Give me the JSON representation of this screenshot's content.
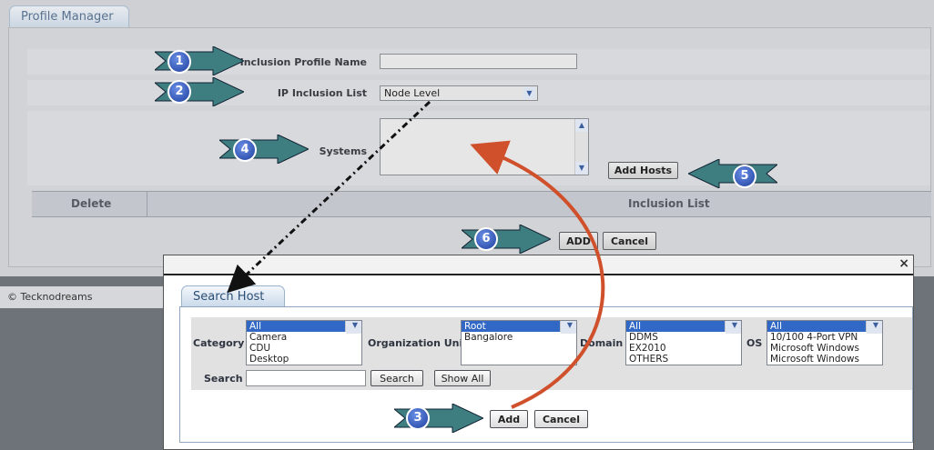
{
  "profile_manager": {
    "tab": "Profile Manager",
    "labels": {
      "inclusion_profile_name": "Inclusion Profile Name",
      "ip_inclusion_list": "IP Inclusion List",
      "systems": "Systems"
    },
    "inclusion_profile_name_value": "",
    "ip_inclusion_list_value": "Node Level",
    "add_hosts": "Add Hosts",
    "grid_headers": [
      "Delete",
      "Inclusion List"
    ],
    "add": "ADD",
    "cancel": "Cancel"
  },
  "footer": {
    "text": "© Tecknodreams"
  },
  "dialog": {
    "close": "×",
    "tab": "Search Host",
    "filters": {
      "category": {
        "label": "Category",
        "options": [
          "All",
          "Camera",
          "CDU",
          "Desktop"
        ],
        "selected": "All"
      },
      "organization_unit": {
        "label": "Organization Unit",
        "options": [
          "Root",
          "Bangalore"
        ],
        "selected": "Root"
      },
      "domain": {
        "label": "Domain",
        "options": [
          "All",
          "DDMS",
          "EX2010",
          "OTHERS"
        ],
        "selected": "All"
      },
      "os": {
        "label": "OS",
        "options": [
          "All",
          "10/100 4-Port VPN",
          "Microsoft Windows",
          "Microsoft Windows"
        ],
        "selected": "All"
      }
    },
    "search_label": "Search",
    "search_value": "",
    "search_button": "Search",
    "show_all_button": "Show All",
    "add": "Add",
    "cancel": "Cancel"
  },
  "callouts": [
    "1",
    "2",
    "3",
    "4",
    "5",
    "6"
  ],
  "colors": {
    "arrow_fill": "#3f7e80",
    "badge": "#2a4fb8",
    "connector_red": "#d0502c"
  }
}
